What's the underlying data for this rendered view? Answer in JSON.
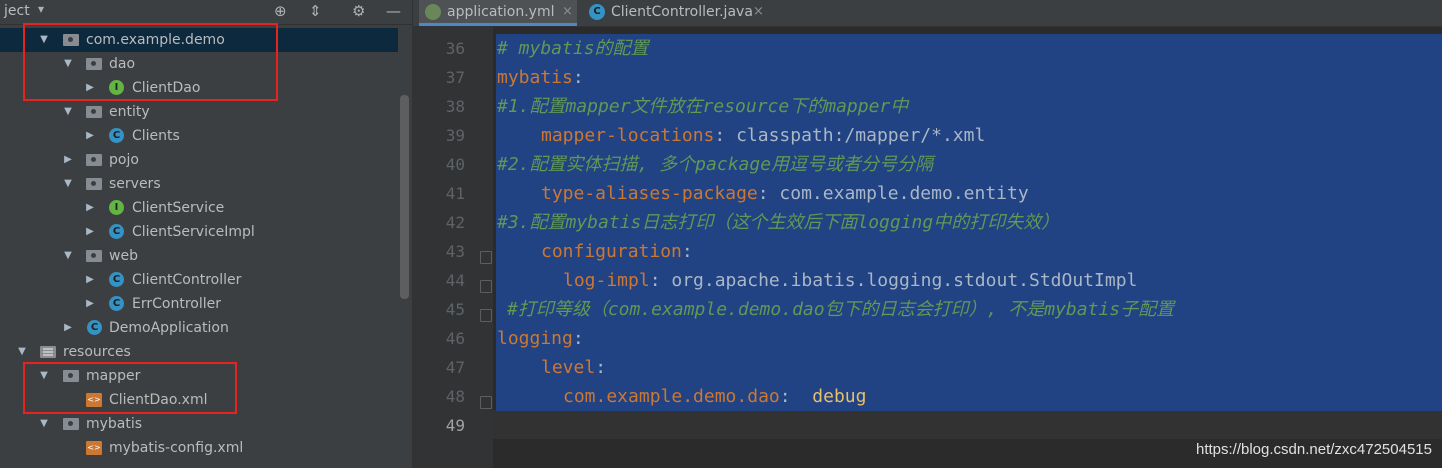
{
  "project_panel": {
    "title": "ject",
    "toolbar_icons": [
      "target-icon",
      "collapse-icon",
      "gear-icon",
      "minimize-icon"
    ],
    "tree": [
      {
        "label": "com.example.demo",
        "type": "package",
        "expanded": true,
        "selected": true
      },
      {
        "label": "dao",
        "type": "package",
        "expanded": true
      },
      {
        "label": "ClientDao",
        "type": "interface",
        "expanded": false
      },
      {
        "label": "entity",
        "type": "package",
        "expanded": true
      },
      {
        "label": "Clients",
        "type": "class",
        "expanded": false
      },
      {
        "label": "pojo",
        "type": "package",
        "expanded": false
      },
      {
        "label": "servers",
        "type": "package",
        "expanded": true
      },
      {
        "label": "ClientService",
        "type": "interface",
        "expanded": false
      },
      {
        "label": "ClientServiceImpl",
        "type": "class",
        "expanded": false
      },
      {
        "label": "web",
        "type": "package",
        "expanded": true
      },
      {
        "label": "ClientController",
        "type": "class",
        "expanded": false
      },
      {
        "label": "ErrController",
        "type": "class",
        "expanded": false
      },
      {
        "label": "DemoApplication",
        "type": "app",
        "expanded": false
      },
      {
        "label": "resources",
        "type": "resources",
        "expanded": true
      },
      {
        "label": "mapper",
        "type": "package",
        "expanded": true
      },
      {
        "label": "ClientDao.xml",
        "type": "xml"
      },
      {
        "label": "mybatis",
        "type": "package",
        "expanded": true
      },
      {
        "label": "mybatis-config.xml",
        "type": "xml"
      }
    ]
  },
  "editor": {
    "tabs": [
      {
        "label": "application.yml",
        "icon": "yml-file-icon",
        "active": true,
        "close": "×"
      },
      {
        "label": "ClientController.java",
        "icon": "java-class-icon",
        "active": false,
        "close": "×"
      }
    ],
    "line_numbers": [
      "36",
      "37",
      "38",
      "39",
      "40",
      "41",
      "42",
      "43",
      "44",
      "45",
      "46",
      "47",
      "48",
      "49"
    ],
    "current_line": "49",
    "code": {
      "l36": "# mybatis的配置",
      "l37_key": "mybatis",
      "l37_colon": ":",
      "l38": "#1.配置mapper文件放在resource下的mapper中",
      "l39_key": "mapper-locations",
      "l39_val": ": classpath:/mapper/*.xml",
      "l40": "#2.配置实体扫描, 多个package用逗号或者分号分隔",
      "l41_key": "type-aliases-package",
      "l41_val": ": com.example.demo.entity",
      "l42": "#3.配置mybatis日志打印（这个生效后下面logging中的打印失效）",
      "l43_key": "configuration",
      "l43_colon": ":",
      "l44_key": "log-impl",
      "l44_val": ": org.apache.ibatis.logging.stdout.StdOutImpl",
      "l45": "#打印等级（com.example.demo.dao包下的日志会打印）, 不是mybatis子配置",
      "l46_key": "logging",
      "l46_colon": ":",
      "l47_key": "level",
      "l47_colon": ":",
      "l48_key": "com.example.demo.dao",
      "l48_colon": ":  ",
      "l48_val": "debug"
    }
  },
  "watermark": "https://blog.csdn.net/zxc472504515",
  "colors": {
    "selection": "#214283",
    "highlight_box": "#e8231f",
    "comment": "#629755",
    "key": "#cc7832"
  }
}
